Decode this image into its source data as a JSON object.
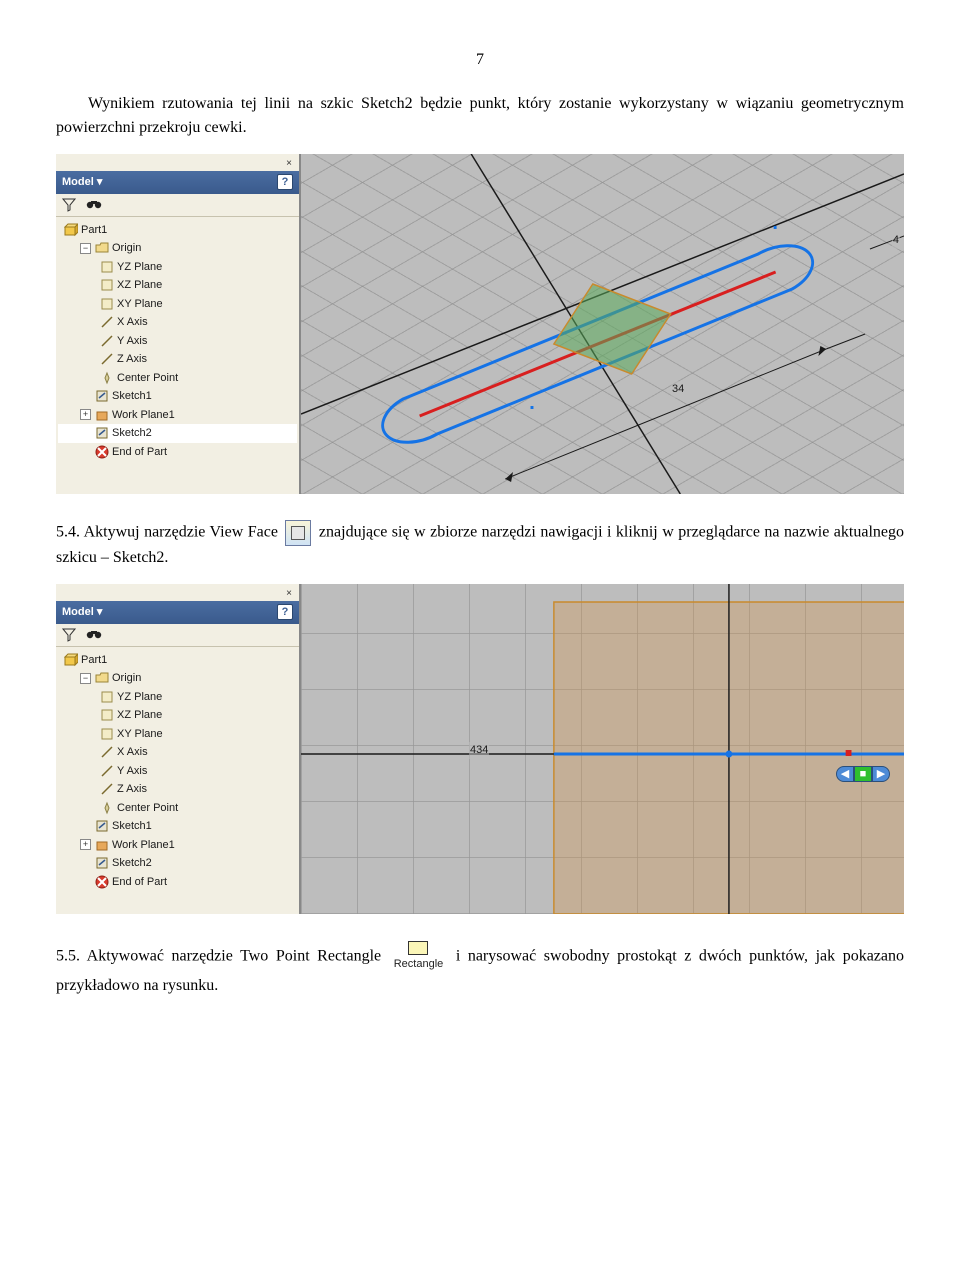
{
  "page_number": "7",
  "para1": "Wynikiem rzutowania tej linii na szkic Sketch2 będzie punkt, który zostanie wykorzystany w wiązaniu geometrycznym powierzchni przekroju cewki.",
  "para2_a": "5.4. Aktywuj narzędzie View Face ",
  "para2_b": " znajdujące się w zbiorze narzędzi nawigacji i kliknij w przeglądarce na nazwie aktualnego szkicu – Sketch2.",
  "para3_a": "5.5. Aktywować narzędzie Two Point Rectangle ",
  "para3_b": " i narysować swobodny prostokąt z dwóch punktów, jak pokazano przykładowo na rysunku.",
  "rect_label": "Rectangle",
  "panel": {
    "title": "Model ▾",
    "help": "?",
    "close": "×"
  },
  "tree": {
    "part": "Part1",
    "origin": "Origin",
    "yz": "YZ Plane",
    "xz": "XZ Plane",
    "xy": "XY Plane",
    "xaxis": "X Axis",
    "yaxis": "Y Axis",
    "zaxis": "Z Axis",
    "center": "Center Point",
    "sketch1": "Sketch1",
    "wp1": "Work Plane1",
    "sketch2": "Sketch2",
    "eop": "End of Part"
  },
  "dims": {
    "d1": "34",
    "d2": "4",
    "d3": "434"
  },
  "toggle": {
    "minus": "−",
    "plus": "+"
  }
}
